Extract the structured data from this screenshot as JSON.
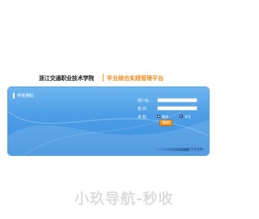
{
  "header": {
    "school_name": "浙江交通职业技术学院",
    "platform_name": "毕业综合实践管理平台"
  },
  "panel": {
    "title": "学校通知",
    "username_label": "用户名：",
    "password_label": "密  码：",
    "type_label": "类  型：",
    "username_value": "",
    "password_value": "",
    "radio_options": [
      {
        "label": "教师",
        "checked": false
      },
      {
        "label": "学生",
        "checked": true
      }
    ],
    "login_button": "登录",
    "footer_text": "技术支持"
  },
  "watermark": "小玖导航-秒收",
  "colors": {
    "panel_blue": "#4d9ee6",
    "accent_orange": "#f08a1a"
  }
}
